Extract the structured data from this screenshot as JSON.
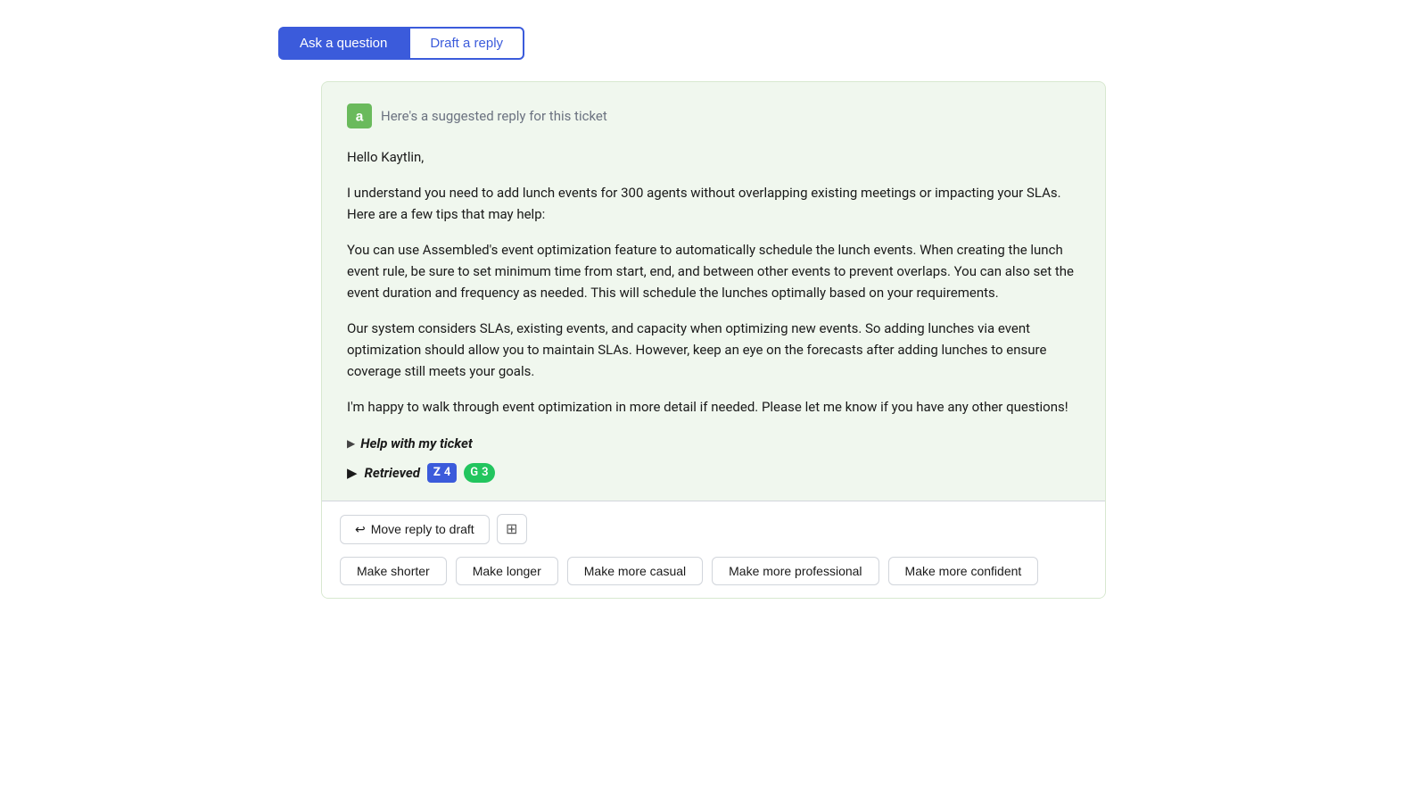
{
  "tabs": [
    {
      "id": "ask-question",
      "label": "Ask a question",
      "active": true
    },
    {
      "id": "draft-reply",
      "label": "Draft a reply",
      "active": false
    }
  ],
  "card": {
    "header_text": "Here's a suggested reply for this ticket",
    "paragraphs": [
      "Hello Kaytlin,",
      "I understand you need to add lunch events for 300 agents without overlapping existing meetings or impacting your SLAs. Here are a few tips that may help:",
      "You can use Assembled's event optimization feature to automatically schedule the lunch events. When creating the lunch event rule, be sure to set minimum time from start, end, and between other events to prevent overlaps. You can also set the event duration and frequency as needed. This will schedule the lunches optimally based on your requirements.",
      "Our system considers SLAs, existing events, and capacity when optimizing new events. So adding lunches via event optimization should allow you to maintain SLAs. However, keep an eye on the forecasts after adding lunches to ensure coverage still meets your goals.",
      "I'm happy to walk through event optimization in more detail if needed. Please let me know if you have any other questions!"
    ],
    "help_label": "Help with my ticket",
    "retrieved_label": "Retrieved",
    "badge_z_count": "4",
    "badge_g_count": "3"
  },
  "actions": {
    "move_draft_label": "Move reply to draft",
    "style_buttons": [
      {
        "id": "make-shorter",
        "label": "Make shorter"
      },
      {
        "id": "make-longer",
        "label": "Make longer"
      },
      {
        "id": "make-casual",
        "label": "Make more casual"
      },
      {
        "id": "make-professional",
        "label": "Make more professional"
      },
      {
        "id": "make-confident",
        "label": "Make more confident"
      }
    ]
  }
}
